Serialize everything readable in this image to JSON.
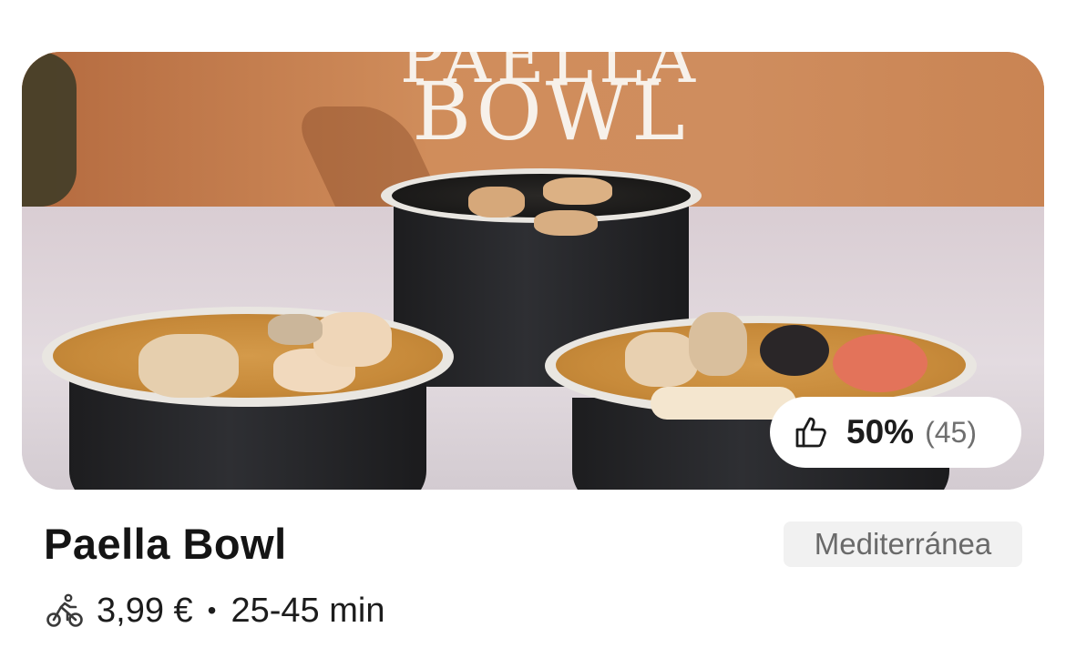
{
  "hero": {
    "banner_top": "PAELLA",
    "banner": "BOWL"
  },
  "rating": {
    "icon": "thumbs-up-icon",
    "percent": "50%",
    "count": "(45)"
  },
  "restaurant": {
    "name": "Paella Bowl",
    "category": "Mediterránea"
  },
  "delivery": {
    "icon": "bike-icon",
    "fee": "3,99 €",
    "separator": "•",
    "time": "25-45 min"
  }
}
